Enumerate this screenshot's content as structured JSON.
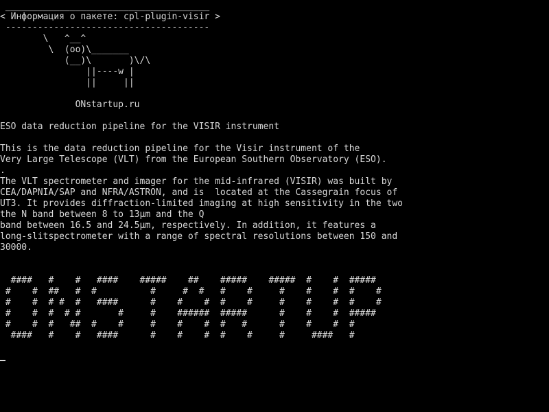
{
  "colors": {
    "background": "#000000",
    "foreground": "#d8d8d8"
  },
  "terminal": {
    "banner_rule_top": " ______________________________________",
    "banner_title": "< Информация о пакете: cpl-plugin-visir >",
    "banner_rule_bottom": " --------------------------------------",
    "cow": [
      "        \\   ^__^",
      "         \\  (oo)\\_______",
      "            (__)\\       )\\/\\",
      "                ||----w |",
      "                ||     ||"
    ],
    "site_credit": "              ONstartup.ru",
    "description": [
      "ESO data reduction pipeline for the VISIR instrument",
      "",
      "This is the data reduction pipeline for the Visir instrument of the",
      "Very Large Telescope (VLT) from the European Southern Observatory (ESO).",
      ".",
      "The VLT spectrometer and imager for the mid-infrared (VISIR) was built by",
      "CEA/DAPNIA/SAP and NFRA/ASTRON, and is  located at the Cassegrain focus of",
      "UT3. It provides diffraction-limited imaging at high sensitivity in the two",
      "the N band between 8 to 13µm and the Q",
      "band between 16.5 and 24.5µm, respectively. In addition, it features a",
      "long-slitspectrometer with a range of spectral resolutions between 150 and",
      "30000."
    ],
    "figlet": [
      "  ####   #    #   ####    #####    ##    #####    #####  #    #  #####",
      " #    #  ##   #  #          #     #  #   #    #     #    #    #  #    #",
      " #    #  # #  #   ####      #    #    #  #    #     #    #    #  #    #",
      " #    #  #  # #       #     #    ######  #####      #    #    #  #####",
      " #    #  #   ##  #    #     #    #    #  #   #      #    #    #  #",
      "  ####   #    #   ####      #    #    #  #    #     #     ####   #"
    ]
  }
}
